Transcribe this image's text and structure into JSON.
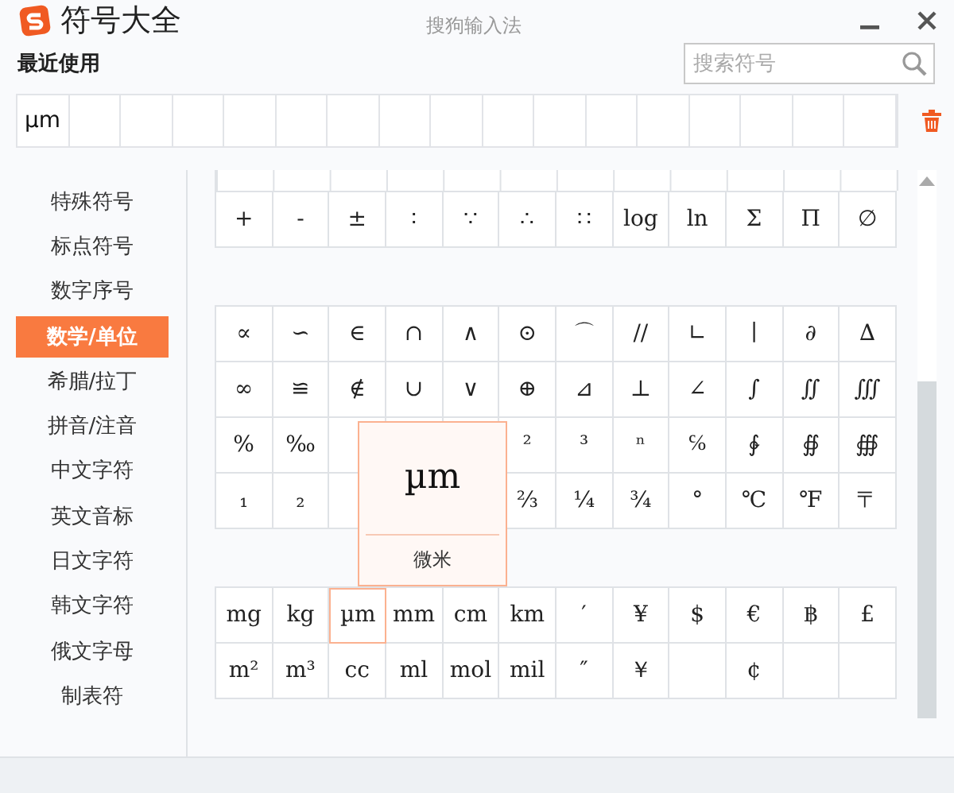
{
  "window": {
    "title": "符号大全",
    "app_name": "搜狗输入法"
  },
  "recent": {
    "label": "最近使用",
    "items": [
      "µm"
    ]
  },
  "search": {
    "placeholder": "搜索符号"
  },
  "sidebar": {
    "items": [
      {
        "label": "特殊符号",
        "selected": false
      },
      {
        "label": "标点符号",
        "selected": false
      },
      {
        "label": "数字序号",
        "selected": false
      },
      {
        "label": "数学/单位",
        "selected": true
      },
      {
        "label": "希腊/拉丁",
        "selected": false
      },
      {
        "label": "拼音/注音",
        "selected": false
      },
      {
        "label": "中文字符",
        "selected": false
      },
      {
        "label": "英文音标",
        "selected": false
      },
      {
        "label": "日文字符",
        "selected": false
      },
      {
        "label": "韩文字符",
        "selected": false
      },
      {
        "label": "俄文字母",
        "selected": false
      },
      {
        "label": "制表符",
        "selected": false
      }
    ]
  },
  "blocks": [
    {
      "rows": [
        [
          {
            "symbol": "+",
            "selected": false
          },
          {
            "symbol": "-",
            "selected": false
          },
          {
            "symbol": "±",
            "selected": false
          },
          {
            "symbol": "∶",
            "selected": false
          },
          {
            "symbol": "∵",
            "selected": false
          },
          {
            "symbol": "∴",
            "selected": false
          },
          {
            "symbol": "∷",
            "selected": false
          },
          {
            "symbol": "log",
            "selected": false
          },
          {
            "symbol": "ln",
            "selected": false
          },
          {
            "symbol": "Σ",
            "selected": false
          },
          {
            "symbol": "Π",
            "selected": false
          },
          {
            "symbol": "∅",
            "selected": false
          }
        ]
      ]
    },
    {
      "rows": [
        [
          {
            "symbol": "∝",
            "selected": false
          },
          {
            "symbol": "∽",
            "selected": false
          },
          {
            "symbol": "∈",
            "selected": false
          },
          {
            "symbol": "∩",
            "selected": false
          },
          {
            "symbol": "∧",
            "selected": false
          },
          {
            "symbol": "⊙",
            "selected": false
          },
          {
            "symbol": "⌒",
            "selected": false
          },
          {
            "symbol": "//",
            "selected": false
          },
          {
            "symbol": "∟",
            "selected": false
          },
          {
            "symbol": "∣",
            "selected": false
          },
          {
            "symbol": "∂",
            "selected": false
          },
          {
            "symbol": "∆",
            "selected": false
          }
        ],
        [
          {
            "symbol": "∞",
            "selected": false
          },
          {
            "symbol": "≌",
            "selected": false
          },
          {
            "symbol": "∉",
            "selected": false
          },
          {
            "symbol": "∪",
            "selected": false
          },
          {
            "symbol": "∨",
            "selected": false
          },
          {
            "symbol": "⊕",
            "selected": false
          },
          {
            "symbol": "⊿",
            "selected": false
          },
          {
            "symbol": "⊥",
            "selected": false
          },
          {
            "symbol": "∠",
            "selected": false
          },
          {
            "symbol": "∫",
            "selected": false
          },
          {
            "symbol": "∬",
            "selected": false
          },
          {
            "symbol": "∭",
            "selected": false
          }
        ],
        [
          {
            "symbol": "%",
            "selected": false
          },
          {
            "symbol": "‰",
            "selected": false
          },
          {
            "selected": false
          },
          {
            "selected": false
          },
          {
            "selected": false
          },
          {
            "symbol": "²",
            "selected": false
          },
          {
            "symbol": "³",
            "selected": false
          },
          {
            "symbol": "ⁿ",
            "selected": false
          },
          {
            "symbol": "℅",
            "selected": false
          },
          {
            "symbol": "∲",
            "selected": false
          },
          {
            "symbol": "∯",
            "selected": false
          },
          {
            "symbol": "∰",
            "selected": false
          }
        ],
        [
          {
            "symbol": "₁",
            "selected": false
          },
          {
            "symbol": "₂",
            "selected": false
          },
          {
            "selected": false
          },
          null,
          null,
          {
            "symbol": "⅔",
            "selected": false
          },
          {
            "symbol": "¼",
            "selected": false
          },
          {
            "symbol": "¾",
            "selected": false
          },
          {
            "symbol": "°",
            "selected": false
          },
          {
            "symbol": "℃",
            "selected": false
          },
          {
            "symbol": "℉",
            "selected": false
          },
          {
            "symbol": "〒",
            "selected": false
          }
        ]
      ]
    },
    {
      "rows": [
        [
          {
            "symbol": "mg",
            "selected": false
          },
          {
            "symbol": "kg",
            "selected": false
          },
          {
            "symbol": "µm",
            "selected": true
          },
          {
            "symbol": "mm",
            "selected": false
          },
          {
            "symbol": "cm",
            "selected": false
          },
          {
            "symbol": "km",
            "selected": false
          },
          {
            "symbol": "′",
            "selected": false
          },
          {
            "symbol": "¥",
            "selected": false
          },
          {
            "symbol": "$",
            "selected": false
          },
          {
            "symbol": "€",
            "selected": false
          },
          {
            "symbol": "฿",
            "selected": false
          },
          {
            "symbol": "£",
            "selected": false
          }
        ],
        [
          {
            "symbol": "m²",
            "selected": false
          },
          {
            "symbol": "m³",
            "selected": false
          },
          {
            "symbol": "cc",
            "selected": false
          },
          {
            "symbol": "ml",
            "selected": false
          },
          {
            "symbol": "mol",
            "selected": false
          },
          {
            "symbol": "mil",
            "selected": false
          },
          {
            "symbol": "″",
            "selected": false
          },
          {
            "symbol": "￥",
            "selected": false
          },
          {
            "selected": false
          },
          {
            "symbol": "¢",
            "selected": false
          },
          {
            "selected": false
          },
          {
            "selected": false
          }
        ]
      ]
    }
  ],
  "tooltip": {
    "symbol": "µm",
    "name": "微米"
  }
}
